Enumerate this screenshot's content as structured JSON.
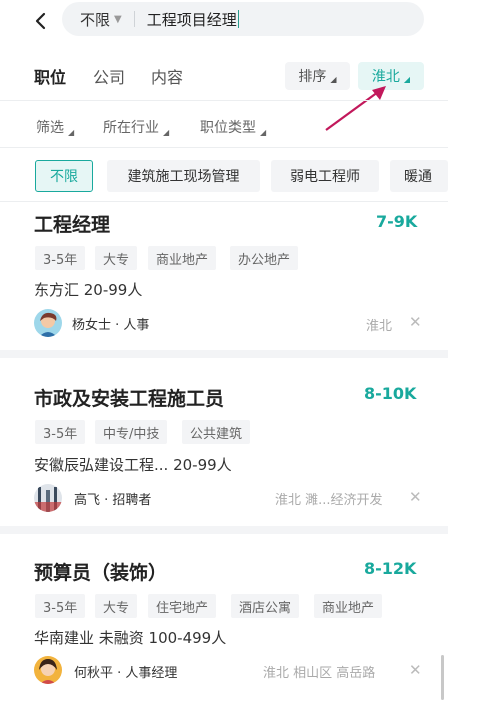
{
  "search": {
    "scope_label": "不限",
    "query": "工程项目经理"
  },
  "tabs": [
    {
      "label": "职位"
    },
    {
      "label": "公司"
    },
    {
      "label": "内容"
    }
  ],
  "sort_label": "排序",
  "area_label": "淮北",
  "filters": [
    {
      "label": "筛选"
    },
    {
      "label": "所在行业"
    },
    {
      "label": "职位类型"
    }
  ],
  "tags": [
    {
      "label": "不限"
    },
    {
      "label": "建筑施工现场管理"
    },
    {
      "label": "弱电工程师"
    },
    {
      "label": "暖通"
    }
  ],
  "jobs": [
    {
      "title": "工程经理",
      "salary": "7-9K",
      "chips": [
        "3-5年",
        "大专",
        "商业地产",
        "办公地产"
      ],
      "company": "东方汇  20-99人",
      "recruiter": "杨女士 · 人事",
      "location": "淮北"
    },
    {
      "title": "市政及安装工程施工员",
      "salary": "8-10K",
      "chips": [
        "3-5年",
        "中专/中技",
        "公共建筑"
      ],
      "company": "安徽辰弘建设工程...  20-99人",
      "recruiter": "高飞 · 招聘者",
      "location": "淮北  濉...经济开发"
    },
    {
      "title": "预算员（装饰）",
      "salary": "8-12K",
      "chips": [
        "3-5年",
        "大专",
        "住宅地产",
        "酒店公寓",
        "商业地产"
      ],
      "company": "华南建业  未融资  100-499人",
      "recruiter": "何秋平 · 人事经理",
      "location": "淮北  相山区  高岳路"
    }
  ],
  "colors": {
    "accent": "#19a99d",
    "arrow": "#c2185b"
  }
}
